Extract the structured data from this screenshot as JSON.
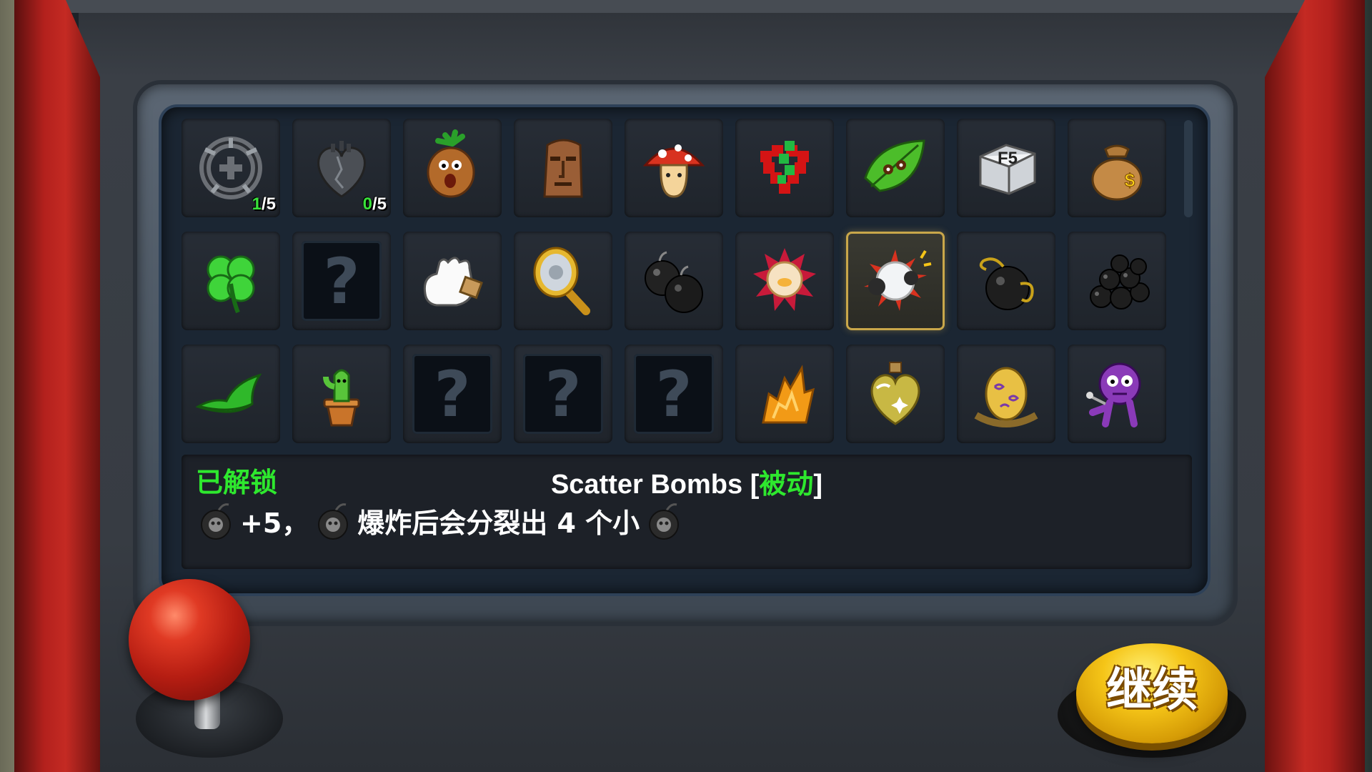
{
  "items": [
    {
      "icon": "chakram-icon",
      "count": "1",
      "max": "5"
    },
    {
      "icon": "stone-heart-icon",
      "count": "0",
      "max": "5"
    },
    {
      "icon": "mandrake-icon"
    },
    {
      "icon": "moai-head-icon"
    },
    {
      "icon": "mushroom-icon"
    },
    {
      "icon": "pixel-heart-icon"
    },
    {
      "icon": "leaf-bug-icon"
    },
    {
      "icon": "f5-key-icon"
    },
    {
      "icon": "money-bag-icon"
    },
    {
      "icon": "four-leaf-clover-icon"
    },
    {
      "icon": "locked-item-icon",
      "locked": true,
      "label": "?"
    },
    {
      "icon": "white-glove-icon"
    },
    {
      "icon": "magic-mirror-icon"
    },
    {
      "icon": "double-bomb-icon"
    },
    {
      "icon": "crystal-ball-icon"
    },
    {
      "icon": "scatter-bomb-icon",
      "selected": true
    },
    {
      "icon": "fuse-bomb-icon"
    },
    {
      "icon": "bomb-pile-icon"
    },
    {
      "icon": "green-hat-icon"
    },
    {
      "icon": "potted-cactus-icon"
    },
    {
      "icon": "locked-item-icon",
      "locked": true,
      "label": "?"
    },
    {
      "icon": "locked-item-icon",
      "locked": true,
      "label": "?"
    },
    {
      "icon": "locked-item-icon",
      "locked": true,
      "label": "?"
    },
    {
      "icon": "flame-shard-icon"
    },
    {
      "icon": "heart-potion-icon"
    },
    {
      "icon": "spotted-egg-icon"
    },
    {
      "icon": "voodoo-doll-icon"
    }
  ],
  "info": {
    "status": "已解锁",
    "name": "Scatter Bombs",
    "bracket_open": "[",
    "tag": "被动",
    "bracket_close": "]",
    "bonus": "+5，",
    "effect": "爆炸后会分裂出 4 个小"
  },
  "continue_label": "继续",
  "colors": {
    "accent_green": "#2ee82e",
    "selected_border": "#c9a74a",
    "button_yellow": "#f5c518",
    "cabinet_red": "#c42a23"
  }
}
